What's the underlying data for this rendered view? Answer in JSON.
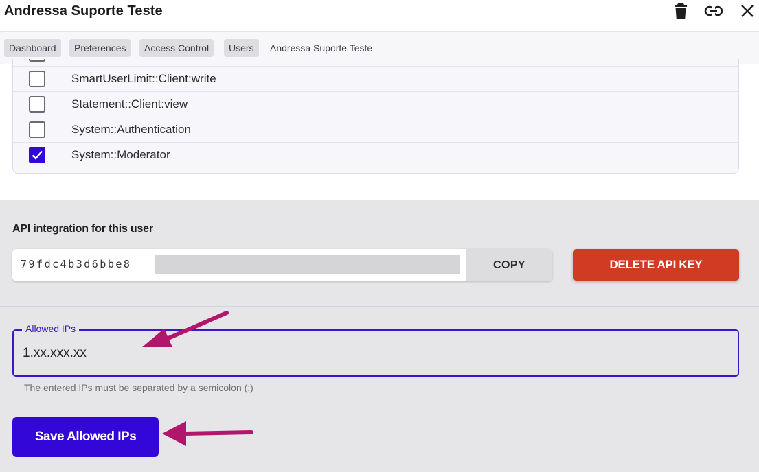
{
  "header": {
    "title": "Andressa Suporte Teste",
    "icons": [
      "trash-icon",
      "link-icon",
      "close-icon"
    ]
  },
  "breadcrumb": {
    "items": [
      "Dashboard",
      "Preferences",
      "Access Control",
      "Users"
    ],
    "current": "Andressa Suporte Teste"
  },
  "permissions": [
    {
      "label": "SmartUserLimit::Client:write",
      "checked": false
    },
    {
      "label": "Statement::Client:view",
      "checked": false
    },
    {
      "label": "System::Authentication",
      "checked": false
    },
    {
      "label": "System::Moderator",
      "checked": true
    }
  ],
  "api": {
    "title": "API integration for this user",
    "key_visible": "79fdc4b3d6bbe8",
    "copy_label": "COPY",
    "delete_label": "DELETE API KEY"
  },
  "allowed_ips": {
    "legend": "Allowed IPs",
    "value": "1.xx.xxx.xx",
    "helper": "The entered IPs must be separated by a semicolon (;)",
    "save_label": "Save Allowed IPs"
  },
  "colors": {
    "accent": "#3207d8",
    "danger": "#d03b24",
    "annotation_arrow": "#b0176c"
  }
}
